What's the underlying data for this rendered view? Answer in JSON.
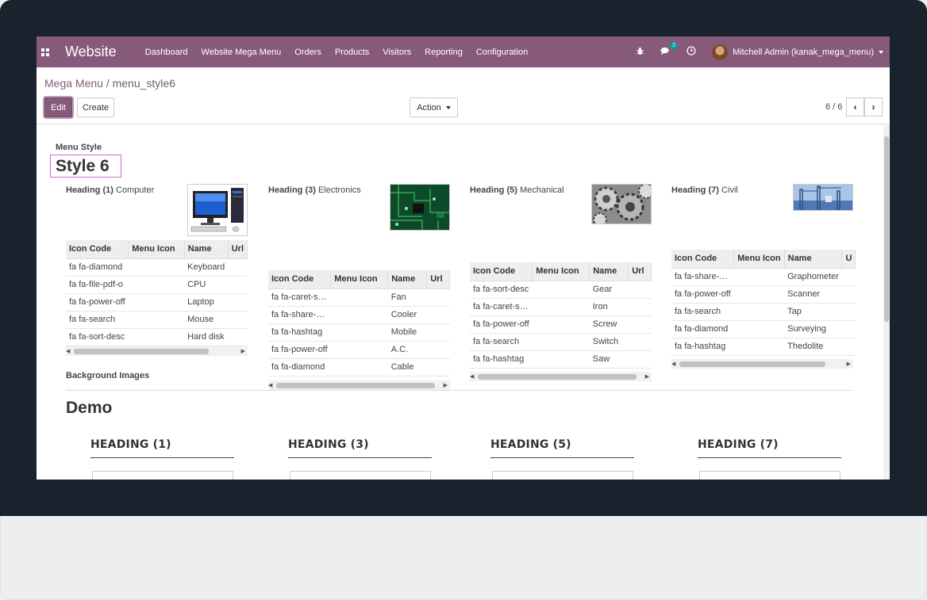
{
  "navbar": {
    "brand": "Website",
    "menu": [
      "Dashboard",
      "Website Mega Menu",
      "Orders",
      "Products",
      "Visitors",
      "Reporting",
      "Configuration"
    ],
    "icons": [
      "bug-icon",
      "chat-icon",
      "clock-icon"
    ],
    "chat_badge": "2",
    "user": "Mitchell Admin (kanak_mega_menu)",
    "bg_color": "#875a7b"
  },
  "breadcrumb": {
    "parent": "Mega Menu",
    "separator": "/",
    "current": "menu_style6"
  },
  "buttons": {
    "edit": "Edit",
    "create": "Create",
    "action": "Action"
  },
  "pager": {
    "value": "6 / 6"
  },
  "form": {
    "menu_style_label": "Menu Style",
    "menu_style_value": "Style 6",
    "background_images_label": "Background Images",
    "demo_title": "Demo"
  },
  "columns": [
    {
      "heading_label": "Heading (1)",
      "heading_value": "Computer",
      "image": "computer-image",
      "table_headers": [
        "Icon Code",
        "Menu Icon",
        "Name",
        "Url"
      ],
      "rows": [
        [
          "fa fa-diamond",
          "",
          "Keyboard"
        ],
        [
          "fa fa-file-pdf-o",
          "",
          "CPU"
        ],
        [
          "fa fa-power-off",
          "",
          "Laptop"
        ],
        [
          "fa fa-search",
          "",
          "Mouse"
        ],
        [
          "fa fa-sort-desc",
          "",
          "Hard disk"
        ]
      ]
    },
    {
      "heading_label": "Heading (3)",
      "heading_value": "Electronics",
      "image": "circuit-board-image",
      "table_headers": [
        "Icon Code",
        "Menu Icon",
        "Name",
        "Url"
      ],
      "rows": [
        [
          "fa fa-caret-s…",
          "",
          "Fan"
        ],
        [
          "fa fa-share-…",
          "",
          "Cooler"
        ],
        [
          "fa fa-hashtag",
          "",
          "Mobile"
        ],
        [
          "fa fa-power-off",
          "",
          "A.C."
        ],
        [
          "fa fa-diamond",
          "",
          "Cable"
        ]
      ]
    },
    {
      "heading_label": "Heading (5)",
      "heading_value": "Mechanical",
      "image": "gears-image",
      "table_headers": [
        "Icon Code",
        "Menu Icon",
        "Name",
        "Url"
      ],
      "rows": [
        [
          "fa fa-sort-desc",
          "",
          "Gear"
        ],
        [
          "fa fa-caret-s…",
          "",
          "Iron"
        ],
        [
          "fa fa-power-off",
          "",
          "Screw"
        ],
        [
          "fa fa-search",
          "",
          "Switch"
        ],
        [
          "fa fa-hashtag",
          "",
          "Saw"
        ]
      ]
    },
    {
      "heading_label": "Heading (7)",
      "heading_value": "Civil",
      "image": "construction-image",
      "table_headers": [
        "Icon Code",
        "Menu Icon",
        "Name",
        "U"
      ],
      "rows": [
        [
          "fa fa-share-…",
          "",
          "Graphometer"
        ],
        [
          "fa fa-power-off",
          "",
          "Scanner"
        ],
        [
          "fa fa-search",
          "",
          "Tap"
        ],
        [
          "fa fa-diamond",
          "",
          "Surveying"
        ],
        [
          "fa fa-hashtag",
          "",
          "Thedolite"
        ]
      ]
    }
  ],
  "demo_headings": [
    "HEADING (1)",
    "HEADING (3)",
    "HEADING (5)",
    "HEADING (7)"
  ]
}
